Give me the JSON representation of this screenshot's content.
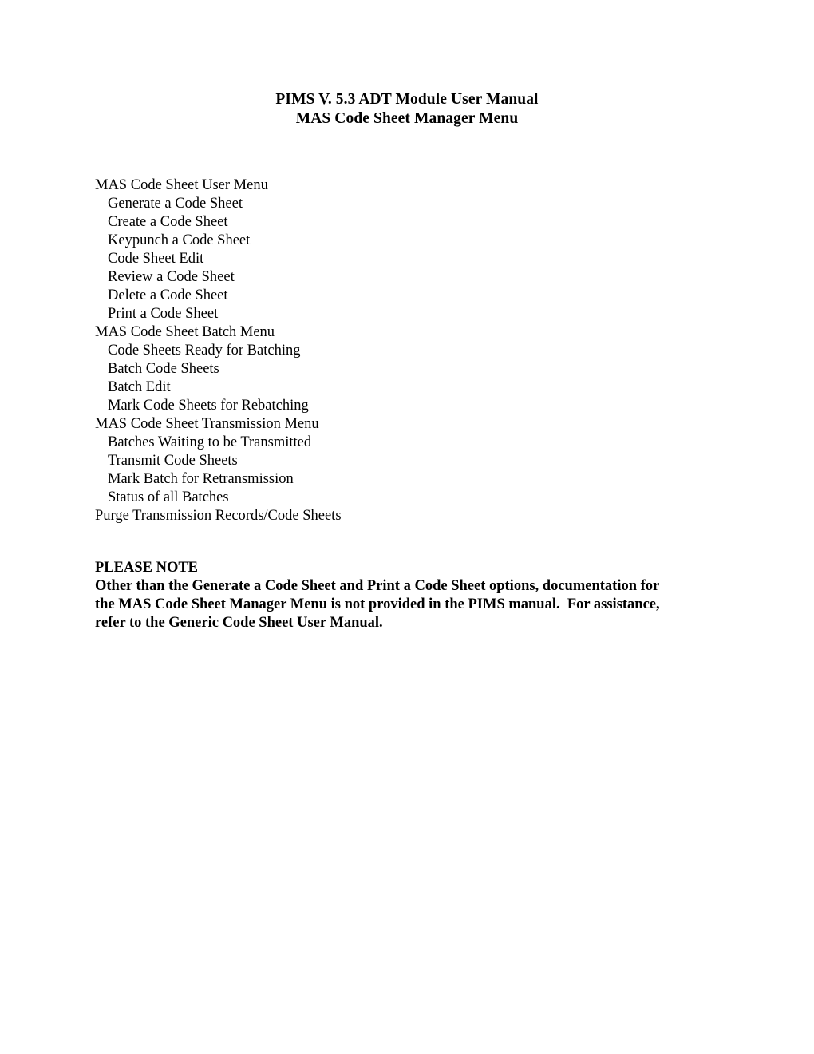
{
  "document": {
    "title_lines": [
      "PIMS V. 5.3 ADT Module User Manual",
      "MAS Code Sheet Manager Menu"
    ],
    "menu_outline": [
      {
        "label": "MAS Code Sheet User Menu",
        "level": 0
      },
      {
        "label": "Generate a Code Sheet",
        "level": 1
      },
      {
        "label": "Create a Code Sheet",
        "level": 1
      },
      {
        "label": "Keypunch a Code Sheet",
        "level": 1
      },
      {
        "label": "Code Sheet Edit",
        "level": 1
      },
      {
        "label": "Review a Code Sheet",
        "level": 1
      },
      {
        "label": "Delete a Code Sheet",
        "level": 1
      },
      {
        "label": "Print a Code Sheet",
        "level": 1
      },
      {
        "label": "MAS Code Sheet Batch Menu",
        "level": 0
      },
      {
        "label": "Code Sheets Ready for Batching",
        "level": 1
      },
      {
        "label": "Batch Code Sheets",
        "level": 1
      },
      {
        "label": "Batch Edit",
        "level": 1
      },
      {
        "label": "Mark Code Sheets for Rebatching",
        "level": 1
      },
      {
        "label": "MAS Code Sheet Transmission Menu",
        "level": 0
      },
      {
        "label": "Batches Waiting to be Transmitted",
        "level": 1
      },
      {
        "label": "Transmit Code Sheets",
        "level": 1
      },
      {
        "label": "Mark Batch for Retransmission",
        "level": 1
      },
      {
        "label": "Status of all Batches",
        "level": 1
      },
      {
        "label": "Purge Transmission Records/Code Sheets",
        "level": 0
      }
    ],
    "note": {
      "heading": "PLEASE NOTE",
      "lines": [
        "Other than the Generate a Code Sheet and Print a Code Sheet options, documentation for",
        "the MAS Code Sheet Manager Menu is not provided in the PIMS manual.  For assistance,",
        "refer to the Generic Code Sheet User Manual."
      ]
    }
  }
}
